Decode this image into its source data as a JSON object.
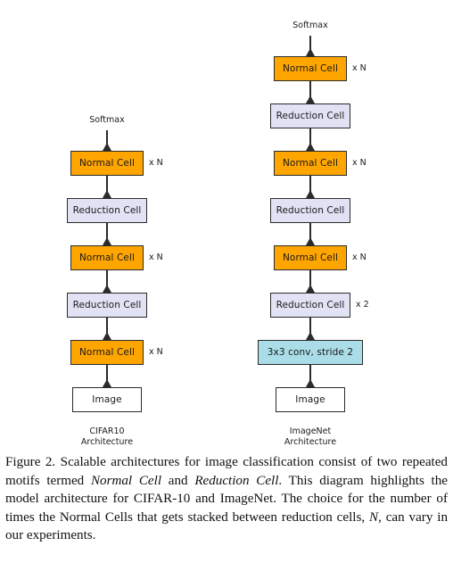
{
  "figure": {
    "softmax_label": "Softmax",
    "mult_n": "x N",
    "mult_2": "x 2",
    "cells": {
      "normal": "Normal Cell",
      "reduction": "Reduction Cell",
      "image": "Image",
      "conv": "3x3 conv, stride 2"
    },
    "columns": [
      {
        "id": "cifar",
        "arch_label": "CIFAR10\nArchitecture",
        "stack": [
          {
            "type": "normal",
            "label": "Normal Cell",
            "mult": "x N"
          },
          {
            "type": "reduction",
            "label": "Reduction Cell",
            "mult": ""
          },
          {
            "type": "normal",
            "label": "Normal Cell",
            "mult": "x N"
          },
          {
            "type": "reduction",
            "label": "Reduction Cell",
            "mult": ""
          },
          {
            "type": "normal",
            "label": "Normal Cell",
            "mult": "x N"
          },
          {
            "type": "image",
            "label": "Image",
            "mult": ""
          }
        ]
      },
      {
        "id": "imagenet",
        "arch_label": "ImageNet\nArchitecture",
        "stack": [
          {
            "type": "normal",
            "label": "Normal Cell",
            "mult": "x N"
          },
          {
            "type": "reduction",
            "label": "Reduction Cell",
            "mult": ""
          },
          {
            "type": "normal",
            "label": "Normal Cell",
            "mult": "x N"
          },
          {
            "type": "reduction",
            "label": "Reduction Cell",
            "mult": ""
          },
          {
            "type": "normal",
            "label": "Normal Cell",
            "mult": "x N"
          },
          {
            "type": "reduction",
            "label": "Reduction Cell",
            "mult": "x 2"
          },
          {
            "type": "conv",
            "label": "3x3 conv, stride 2",
            "mult": ""
          },
          {
            "type": "image",
            "label": "Image",
            "mult": ""
          }
        ]
      }
    ],
    "colors": {
      "normal_cell": "#ffa500",
      "reduction_cell": "#e2e2f5",
      "conv": "#aadde8",
      "image": "#ffffff",
      "stroke": "#2b2b2b"
    }
  },
  "caption": {
    "number": "Figure 2.",
    "text_1": " Scalable architectures for image classification consist of two repeated motifs termed ",
    "italic_1": "Normal Cell",
    "text_2": " and ",
    "italic_2": "Reduction Cell",
    "text_3": ". This diagram highlights the model architecture for CIFAR-10 and ImageNet. The choice for the number of times the Normal Cells that gets stacked between reduction cells, ",
    "italic_3": "N",
    "text_4": ", can vary in our experiments."
  }
}
